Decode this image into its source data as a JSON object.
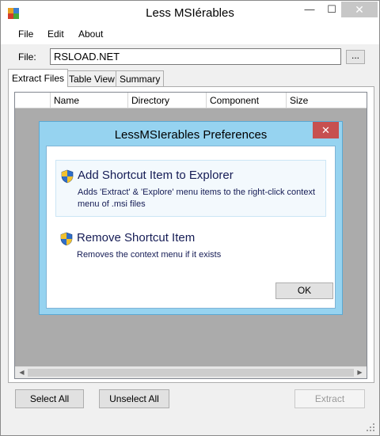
{
  "window": {
    "title": "Less MSIérables",
    "minimize_glyph": "—",
    "maximize_glyph": "☐",
    "close_glyph": "✕"
  },
  "menu": {
    "items": [
      {
        "label": "File"
      },
      {
        "label": "Edit"
      },
      {
        "label": "About"
      }
    ]
  },
  "file": {
    "label": "File:",
    "value": "RSLOAD.NET",
    "browse_label": "..."
  },
  "tabs": [
    {
      "label": "Extract Files",
      "selected": true
    },
    {
      "label": "Table View"
    },
    {
      "label": "Summary"
    }
  ],
  "grid": {
    "columns": [
      {
        "label": ""
      },
      {
        "label": "Name"
      },
      {
        "label": "Directory"
      },
      {
        "label": "Component"
      },
      {
        "label": "Size"
      }
    ],
    "scroll_left": "◀",
    "scroll_right": "▶"
  },
  "dialog": {
    "title": "LessMSIerables Preferences",
    "close_glyph": "✕",
    "options": [
      {
        "title": "Add Shortcut Item to Explorer",
        "description": "Adds 'Extract' & 'Explore' menu items to the right-click context menu of .msi files",
        "icon": "uac-shield-icon"
      },
      {
        "title": "Remove Shortcut Item",
        "description": "Removes the context menu if it exists",
        "icon": "uac-shield-icon"
      }
    ],
    "ok_label": "OK"
  },
  "buttons": {
    "select_all": "Select All",
    "unselect_all": "Unselect All",
    "extract": "Extract"
  },
  "colors": {
    "dialog_frame": "#96d3f0",
    "dialog_close": "#c75050",
    "grid_background": "#ababab",
    "link_text": "#151c55"
  }
}
